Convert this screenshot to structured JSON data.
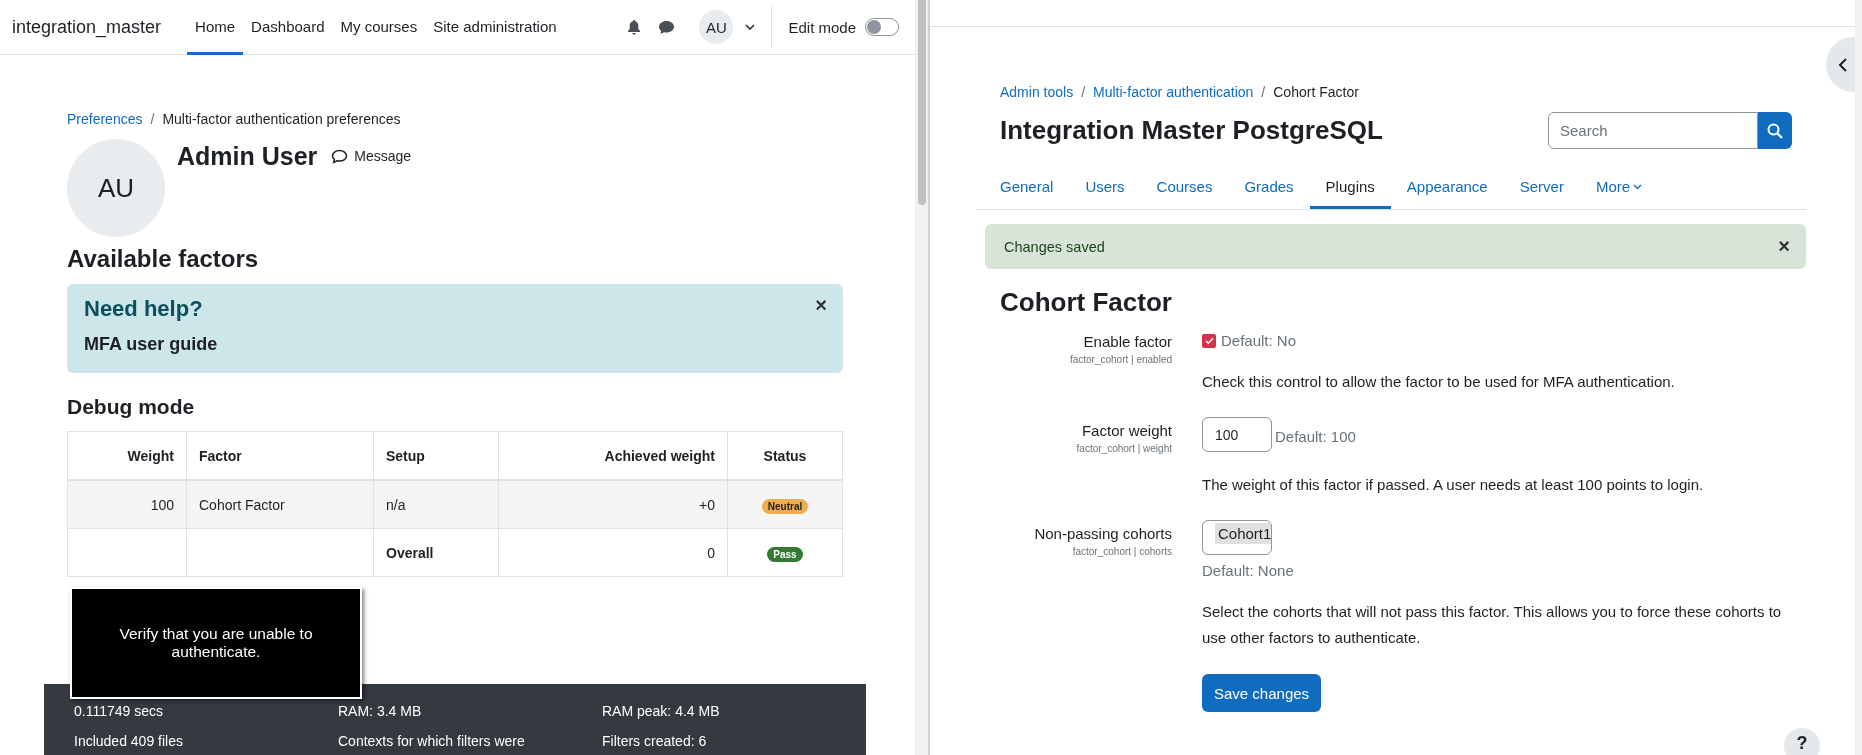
{
  "left_window": {
    "header": {
      "site_name": "integration_master",
      "nav": [
        {
          "label": "Home",
          "selected": true
        },
        {
          "label": "Dashboard",
          "selected": false
        },
        {
          "label": "My courses",
          "selected": false
        },
        {
          "label": "Site administration",
          "selected": false
        }
      ],
      "avatar_initials": "AU",
      "edit_mode": {
        "label": "Edit mode",
        "on": false
      }
    },
    "breadcrumb": [
      {
        "label": "Preferences",
        "kind": "link"
      },
      {
        "separator": "/",
        "label": "Multi-factor authentication preferences",
        "kind": "current"
      }
    ],
    "profile": {
      "initials": "AU",
      "name": "Admin User",
      "message": "Message"
    },
    "heading": "Available factors",
    "help_box": {
      "title": "Need help?",
      "link": "MFA user guide",
      "close": "×"
    },
    "debug": {
      "heading": "Debug mode",
      "columns": [
        "Weight",
        "Factor",
        "Setup",
        "Achieved weight",
        "Status"
      ],
      "rows": [
        {
          "kind": "factor",
          "cells": [
            "100",
            "Cohort Factor",
            "n/a",
            "+0"
          ],
          "status": {
            "label": "Neutral",
            "color": "#f0ad4e"
          }
        },
        {
          "kind": "total",
          "cells": [
            "",
            "",
            "Overall",
            "0"
          ],
          "status": {
            "label": "Pass",
            "color": "#357a32"
          }
        }
      ]
    },
    "overlay": {
      "text": "Verify that you are unable to authenticate."
    },
    "perf_footer": [
      "0.111749 secs",
      "RAM: 3.4 MB",
      "RAM peak: 4.4 MB",
      "Included 409 files",
      "Contexts for which filters were",
      "Filters created: 6"
    ]
  },
  "right_window": {
    "breadcrumb": [
      {
        "label": "Admin tools",
        "kind": "link"
      },
      {
        "separator": "/",
        "label": "Multi-factor authentication",
        "kind": "link"
      },
      {
        "separator": "/",
        "label": "Cohort Factor",
        "kind": "current"
      }
    ],
    "site_title": "Integration Master PostgreSQL",
    "search": {
      "placeholder": "Search"
    },
    "tabs": [
      {
        "label": "General",
        "selected": false,
        "kind": "link"
      },
      {
        "label": "Users",
        "selected": false,
        "kind": "link"
      },
      {
        "label": "Courses",
        "selected": false,
        "kind": "link"
      },
      {
        "label": "Grades",
        "selected": false,
        "kind": "link"
      },
      {
        "label": "Plugins",
        "selected": true,
        "kind": "link"
      },
      {
        "label": "Appearance",
        "selected": false,
        "kind": "link"
      },
      {
        "label": "Server",
        "selected": false,
        "kind": "link"
      },
      {
        "label": "More",
        "selected": false,
        "kind": "menu"
      }
    ],
    "alert": {
      "text": "Changes saved",
      "close": "×"
    },
    "heading": "Cohort Factor",
    "settings": [
      {
        "kind": "checkbox",
        "label": "Enable factor",
        "hint": "factor_cohort | enabled",
        "checked": true,
        "default": "Default: No",
        "description": "Check this control to allow the factor to be used for MFA authentication."
      },
      {
        "kind": "text",
        "label": "Factor weight",
        "hint": "factor_cohort | weight",
        "value": "100",
        "default": "Default: 100",
        "description": "The weight of this factor if passed. A user needs at least 100 points to login."
      },
      {
        "kind": "select",
        "label": "Non-passing cohorts",
        "hint": "factor_cohort | cohorts",
        "value": "Cohort1",
        "default": "Default: None",
        "description": "Select the cohorts that will not pass this factor. This allows you to force these cohorts to use other factors to authenticate."
      }
    ],
    "save_button": "Save changes",
    "help_button": "?"
  }
}
